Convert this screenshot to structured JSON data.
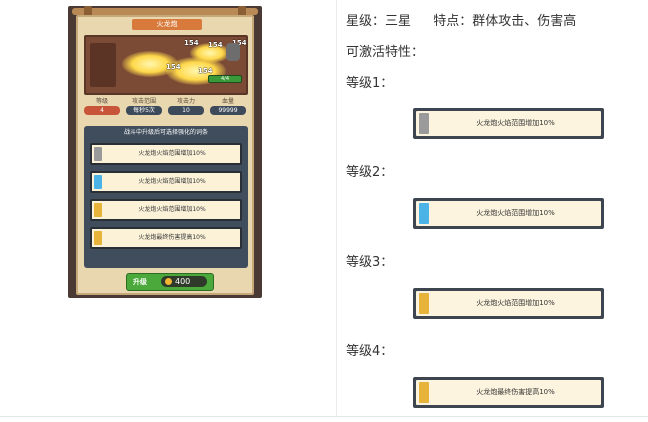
{
  "game_card": {
    "title": "火龙炮",
    "damage_numbers": [
      "154",
      "154",
      "154",
      "154",
      "154"
    ],
    "hp_text": "4/4",
    "stats": [
      {
        "label": "等级",
        "value": "4"
      },
      {
        "label": "攻击范围",
        "value": "每秒5次"
      },
      {
        "label": "攻击力",
        "value": "10"
      },
      {
        "label": "血量",
        "value": "99999"
      }
    ],
    "skills_title": "战斗中升级后可选择强化的词条",
    "skills": [
      {
        "text": "火龙炮火焰范围增加10%",
        "color": "#9a9a9a"
      },
      {
        "text": "火龙炮火焰范围增加10%",
        "color": "#4cb3e6"
      },
      {
        "text": "火龙炮火焰范围增加10%",
        "color": "#e8b33a"
      },
      {
        "text": "火龙炮最终伤害提高10%",
        "color": "#e8b33a"
      }
    ],
    "upgrade_label": "升级",
    "upgrade_cost": "400"
  },
  "info": {
    "rank_text": "星级：三星",
    "feature_text": "特点：群体攻击、伤害高",
    "activatable_text": "可激活特性："
  },
  "levels": [
    {
      "label": "等级1：",
      "skill_text": "火龙炮火焰范围增加10%",
      "color": "#9a9a9a"
    },
    {
      "label": "等级2：",
      "skill_text": "火龙炮火焰范围增加10%",
      "color": "#4cb3e6"
    },
    {
      "label": "等级3：",
      "skill_text": "火龙炮火焰范围增加10%",
      "color": "#e8b33a"
    },
    {
      "label": "等级4：",
      "skill_text": "火龙炮最终伤害提高10%",
      "color": "#e8b33a"
    }
  ]
}
